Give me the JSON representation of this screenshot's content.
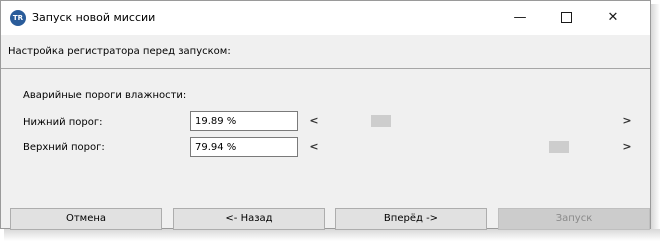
{
  "window": {
    "title": "Запуск новой миссии",
    "app_icon_text": "TR",
    "controls": {
      "minimize": "—",
      "close": "✕"
    }
  },
  "header": {
    "text": "Настройка регистратора перед запуском:"
  },
  "thresholds": {
    "group_label": "Аварийные пороги  влажности:",
    "lower": {
      "label": "Нижний порог:",
      "value": "19.89 %",
      "slider_level": 0.199
    },
    "upper": {
      "label": "Верхний порог:",
      "value": "79.94 %",
      "slider_level": 0.799
    },
    "slider_arrows": {
      "left": "<",
      "right": ">"
    }
  },
  "buttons": {
    "cancel": "Отмена",
    "back": "<- Назад",
    "next": "Вперёд ->",
    "launch": "Запуск"
  }
}
